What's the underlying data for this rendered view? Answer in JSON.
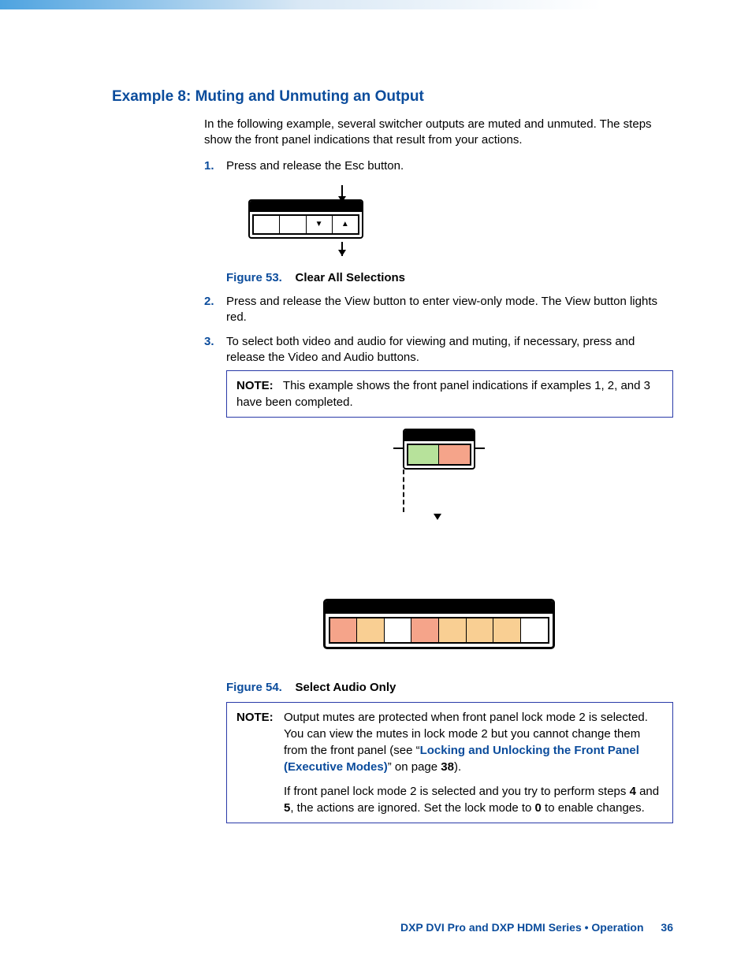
{
  "heading": "Example 8: Muting and Unmuting an Output",
  "intro": "In the following example, several switcher outputs are muted and unmuted. The steps show the front panel indications that result from your actions.",
  "steps": {
    "s1": {
      "num": "1.",
      "text": "Press and release the Esc button."
    },
    "s2": {
      "num": "2.",
      "text": "Press and release the View button to enter view-only mode. The View button lights red."
    },
    "s3": {
      "num": "3.",
      "text": "To select both video and audio for viewing and muting, if necessary, press and release the Video and Audio buttons."
    }
  },
  "figures": {
    "f53": {
      "label": "Figure 53.",
      "title": "Clear All Selections"
    },
    "f54": {
      "label": "Figure 54.",
      "title": "Select Audio Only"
    }
  },
  "notes": {
    "n1": {
      "label": "NOTE:",
      "text": "This example shows the front panel indications if examples 1, 2, and 3 have been completed."
    },
    "n2": {
      "label": "NOTE:",
      "p1a": "Output mutes are protected when front panel lock mode 2 is selected. You can view the mutes in lock mode 2 but you cannot change them from the front panel (see “",
      "link": "Locking and Unlocking the Front Panel (Executive Modes)",
      "p1b": "” on page ",
      "page_ref": "38",
      "p1c": ").",
      "p2a": "If front panel lock mode 2 is selected and you try to perform steps ",
      "p2b": "4",
      "p2c": " and ",
      "p2d": "5",
      "p2e": ", the actions are ignored. Set the lock mode to ",
      "p2f": "0",
      "p2g": " to enable changes."
    }
  },
  "panel1_symbols": {
    "down": "▼",
    "up": "▲"
  },
  "footer": {
    "text": "DXP DVI Pro and DXP HDMI Series • Operation",
    "page": "36"
  }
}
